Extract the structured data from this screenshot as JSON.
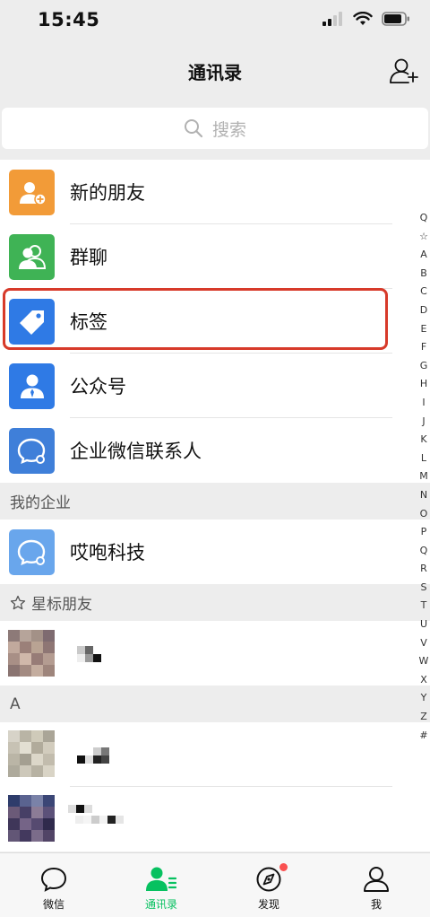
{
  "status_bar": {
    "time": "15:45"
  },
  "nav": {
    "title": "通讯录"
  },
  "search": {
    "placeholder": "搜索"
  },
  "functions": [
    {
      "label": "新的朋友",
      "icon": "new-friend-icon",
      "color": "#f29b38"
    },
    {
      "label": "群聊",
      "icon": "group-chat-icon",
      "color": "#3fb355"
    },
    {
      "label": "标签",
      "icon": "tag-icon",
      "color": "#2f7ae5"
    },
    {
      "label": "公众号",
      "icon": "official-account-icon",
      "color": "#2f7ae5"
    },
    {
      "label": "企业微信联系人",
      "icon": "wecom-icon",
      "color": "#3f7fd9"
    }
  ],
  "sections": {
    "my_enterprise": {
      "title": "我的企业",
      "items": [
        {
          "label": "哎咆科技"
        }
      ]
    },
    "starred": {
      "title": "星标朋友"
    },
    "letter_a": {
      "title": "A"
    }
  },
  "index_letters": [
    "Q",
    "☆",
    "A",
    "B",
    "C",
    "D",
    "E",
    "F",
    "G",
    "H",
    "I",
    "J",
    "K",
    "L",
    "M",
    "N",
    "O",
    "P",
    "Q",
    "R",
    "S",
    "T",
    "U",
    "V",
    "W",
    "X",
    "Y",
    "Z",
    "#"
  ],
  "tabs": [
    {
      "label": "微信",
      "icon": "chat-icon",
      "active": false
    },
    {
      "label": "通讯录",
      "icon": "contacts-icon",
      "active": true
    },
    {
      "label": "发现",
      "icon": "discover-icon",
      "active": false
    },
    {
      "label": "我",
      "icon": "me-icon",
      "active": false
    }
  ],
  "colors": {
    "accent": "#07c160",
    "highlight": "#d73a2a",
    "badge": "#fa5151"
  }
}
